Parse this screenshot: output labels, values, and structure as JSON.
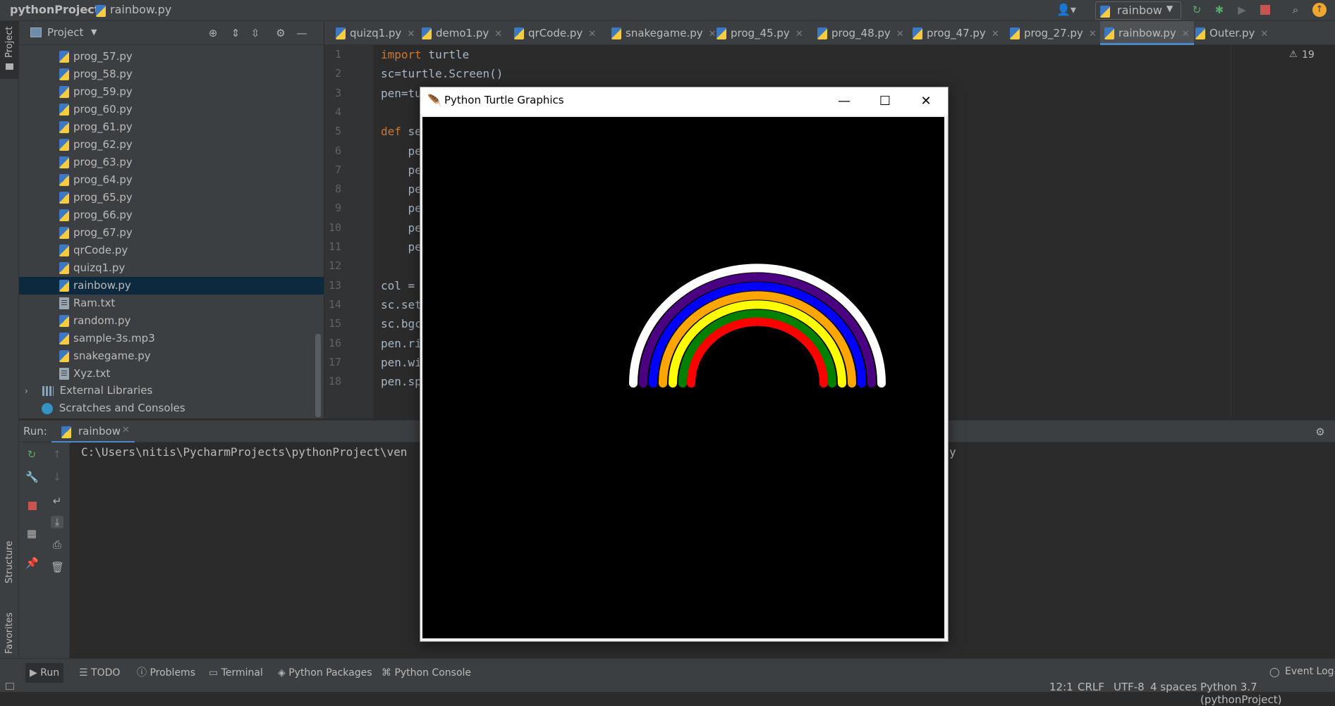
{
  "title_bar": {
    "project": "pythonProject",
    "file": "rainbow.py",
    "run_config": "rainbow"
  },
  "left_strip": {
    "project_label": "Project",
    "structure_label": "Structure",
    "favorites_label": "Favorites"
  },
  "project_panel": {
    "header": "Project",
    "items": [
      {
        "name": "prog_57.py",
        "type": "py"
      },
      {
        "name": "prog_58.py",
        "type": "py"
      },
      {
        "name": "prog_59.py",
        "type": "py"
      },
      {
        "name": "prog_60.py",
        "type": "py"
      },
      {
        "name": "prog_61.py",
        "type": "py"
      },
      {
        "name": "prog_62.py",
        "type": "py"
      },
      {
        "name": "prog_63.py",
        "type": "py"
      },
      {
        "name": "prog_64.py",
        "type": "py"
      },
      {
        "name": "prog_65.py",
        "type": "py"
      },
      {
        "name": "prog_66.py",
        "type": "py"
      },
      {
        "name": "prog_67.py",
        "type": "py"
      },
      {
        "name": "qrCode.py",
        "type": "py"
      },
      {
        "name": "quizq1.py",
        "type": "py"
      },
      {
        "name": "rainbow.py",
        "type": "py",
        "selected": true
      },
      {
        "name": "Ram.txt",
        "type": "txt"
      },
      {
        "name": "random.py",
        "type": "py"
      },
      {
        "name": "sample-3s.mp3",
        "type": "py"
      },
      {
        "name": "snakegame.py",
        "type": "py"
      },
      {
        "name": "Xyz.txt",
        "type": "txt"
      }
    ],
    "external_libraries": "External Libraries",
    "scratches": "Scratches and Consoles"
  },
  "editor_tabs": [
    {
      "label": "quizq1.py"
    },
    {
      "label": "demo1.py"
    },
    {
      "label": "qrCode.py"
    },
    {
      "label": "snakegame.py"
    },
    {
      "label": "prog_45.py"
    },
    {
      "label": "prog_48.py"
    },
    {
      "label": "prog_47.py"
    },
    {
      "label": "prog_27.py"
    },
    {
      "label": "rainbow.py",
      "active": true
    },
    {
      "label": "Outer.py"
    }
  ],
  "editor": {
    "warning_count": "19",
    "line_numbers": [
      "1",
      "2",
      "3",
      "4",
      "5",
      "6",
      "7",
      "8",
      "9",
      "10",
      "11",
      "12",
      "13",
      "14",
      "15",
      "16",
      "17",
      "18"
    ],
    "lines": [
      {
        "kw": "import",
        "rest": " turtle"
      },
      {
        "kw": "",
        "rest": "sc=turtle.Screen()"
      },
      {
        "kw": "",
        "rest": "pen=tu"
      },
      {
        "kw": "",
        "rest": ""
      },
      {
        "kw": "def",
        "rest": " se"
      },
      {
        "kw": "",
        "rest": "    pe"
      },
      {
        "kw": "",
        "rest": "    pe"
      },
      {
        "kw": "",
        "rest": "    pe"
      },
      {
        "kw": "",
        "rest": "    pe"
      },
      {
        "kw": "",
        "rest": "    pe"
      },
      {
        "kw": "",
        "rest": "    pe"
      },
      {
        "kw": "",
        "rest": ""
      },
      {
        "kw": "",
        "rest": "col = "
      },
      {
        "kw": "",
        "rest": "sc.set"
      },
      {
        "kw": "",
        "rest": "sc.bgc"
      },
      {
        "kw": "",
        "rest": "pen.ri"
      },
      {
        "kw": "",
        "rest": "pen.wi"
      },
      {
        "kw": "",
        "rest": "pen.sp"
      }
    ]
  },
  "run_panel": {
    "run_label": "Run:",
    "tab": "rainbow",
    "command": "C:\\Users\\nitis\\PycharmProjects\\pythonProject\\ven",
    "command_tail": "y"
  },
  "turtle_window": {
    "title": "Python Turtle Graphics",
    "background": "#000000",
    "rainbow_colors": [
      "#ffffff",
      "#4b0082",
      "#0000ff",
      "#ffa500",
      "#ffff00",
      "#008000",
      "#ff0000"
    ]
  },
  "bottom_tabs": [
    "Run",
    "TODO",
    "Problems",
    "Terminal",
    "Python Packages",
    "Python Console"
  ],
  "status": {
    "event_log": "Event Log",
    "position": "12:1",
    "line_sep": "CRLF",
    "encoding": "UTF-8",
    "indent": "4 spaces",
    "interpreter": "Python 3.7 (pythonProject)"
  }
}
